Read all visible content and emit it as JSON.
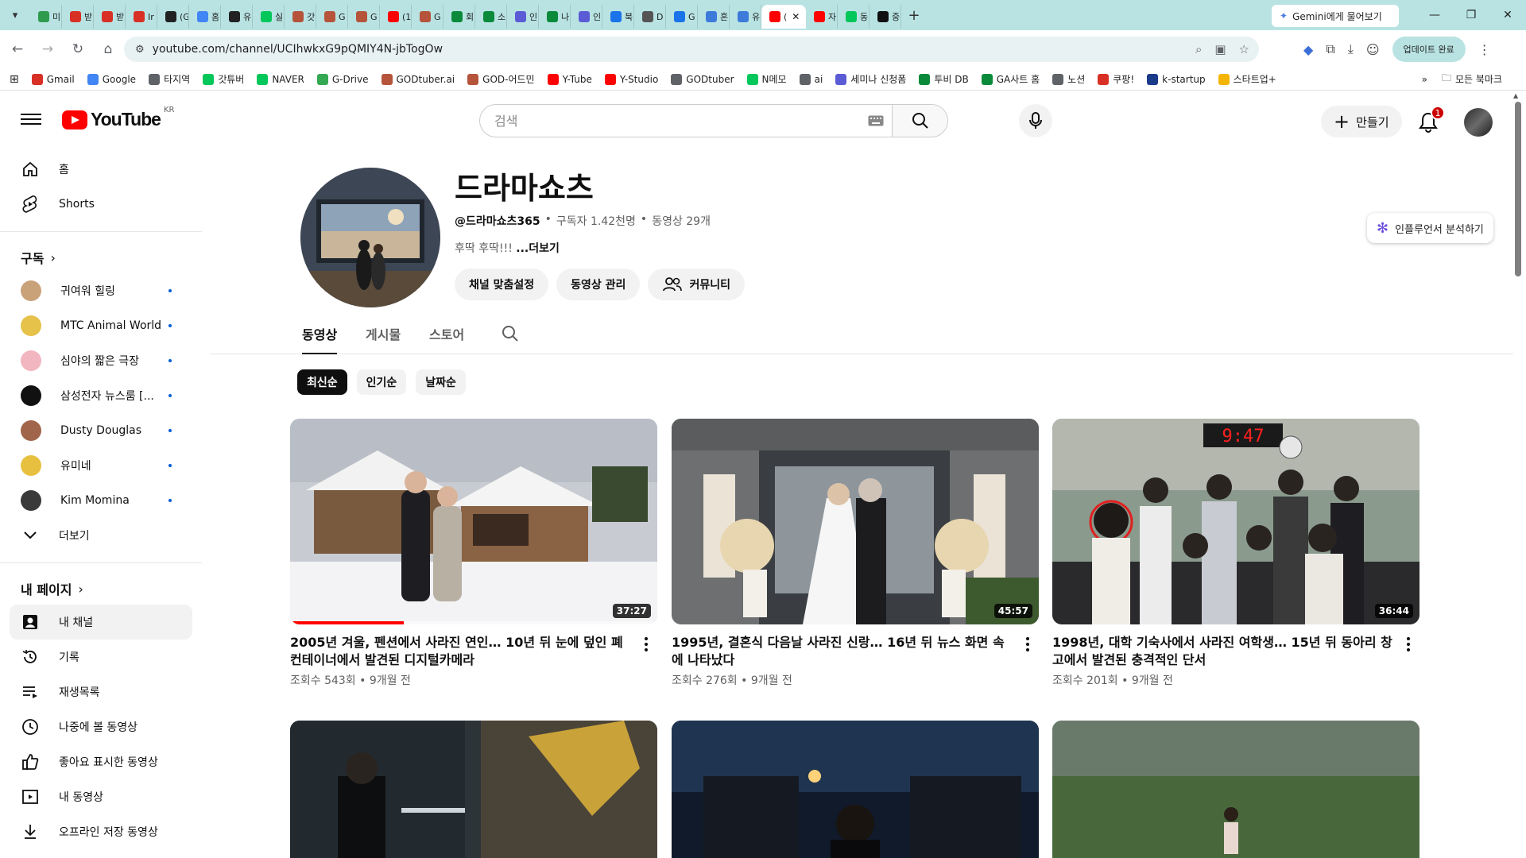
{
  "browser": {
    "tabs": [
      {
        "label": "미",
        "color": "#2e9b4f"
      },
      {
        "label": "받",
        "color": "#d93025"
      },
      {
        "label": "받",
        "color": "#d93025"
      },
      {
        "label": "Ir",
        "color": "#d93025"
      },
      {
        "label": "(G",
        "color": "#222222"
      },
      {
        "label": "홈",
        "color": "#4285f4"
      },
      {
        "label": "유",
        "color": "#222222"
      },
      {
        "label": "실",
        "color": "#03c75a"
      },
      {
        "label": "갓",
        "color": "#b5543b"
      },
      {
        "label": "G",
        "color": "#b5543b"
      },
      {
        "label": "G",
        "color": "#b5543b"
      },
      {
        "label": "(1",
        "color": "#ff0000"
      },
      {
        "label": "G",
        "color": "#b5543b"
      },
      {
        "label": "회",
        "color": "#0a8a3a"
      },
      {
        "label": "소",
        "color": "#0a8a3a"
      },
      {
        "label": "인",
        "color": "#5b5bd6"
      },
      {
        "label": "나",
        "color": "#0a8a3a"
      },
      {
        "label": "인",
        "color": "#5b5bd6"
      },
      {
        "label": "북",
        "color": "#1a73e8"
      },
      {
        "label": "D",
        "color": "#555555"
      },
      {
        "label": "G",
        "color": "#1a73e8"
      },
      {
        "label": "혼",
        "color": "#3c7bd9"
      },
      {
        "label": "유",
        "color": "#3c7bd9"
      },
      {
        "label": "(",
        "color": "#ff0000",
        "active": true
      },
      {
        "label": "자",
        "color": "#ff0000"
      },
      {
        "label": "동",
        "color": "#03c75a"
      },
      {
        "label": "중",
        "color": "#111111"
      }
    ],
    "new_tab": "+",
    "gemini_label": "Gemini에게 물어보기",
    "url": "youtube.com/channel/UCIhwkxG9pQMIY4N-jbTogOw",
    "update_label": "업데이트 완료",
    "bookmarks": [
      {
        "label": "Gmail",
        "color": "#d93025"
      },
      {
        "label": "Google",
        "color": "#4285f4"
      },
      {
        "label": "타지역",
        "color": "#5f6368"
      },
      {
        "label": "갓튜버",
        "color": "#03c75a"
      },
      {
        "label": "NAVER",
        "color": "#03c75a"
      },
      {
        "label": "G-Drive",
        "color": "#34a853"
      },
      {
        "label": "GODtuber.ai",
        "color": "#b5543b"
      },
      {
        "label": "GOD-어드민",
        "color": "#b5543b"
      },
      {
        "label": "Y-Tube",
        "color": "#ff0000"
      },
      {
        "label": "Y-Studio",
        "color": "#ff0000"
      },
      {
        "label": "GODtuber",
        "color": "#5f6368"
      },
      {
        "label": "N메모",
        "color": "#03c75a"
      },
      {
        "label": "ai",
        "color": "#5f6368"
      },
      {
        "label": "세미나 신청폼",
        "color": "#5b5bd6"
      },
      {
        "label": "투비 DB",
        "color": "#0a8a3a"
      },
      {
        "label": "GA사트 홈",
        "color": "#0a8a3a"
      },
      {
        "label": "노션",
        "color": "#5f6368"
      },
      {
        "label": "쿠팡!",
        "color": "#d93025"
      },
      {
        "label": "k-startup",
        "color": "#1a3a8a"
      },
      {
        "label": "스타트업+",
        "color": "#f5b400"
      }
    ],
    "all_bookmarks": "모든 북마크"
  },
  "masthead": {
    "logo_text": "YouTube",
    "logo_region": "KR",
    "search_placeholder": "검색",
    "create_label": "만들기",
    "notif_count": "1"
  },
  "sidebar": {
    "home": "홈",
    "shorts": "Shorts",
    "subs_header": "구독",
    "subscriptions": [
      {
        "name": "귀여워 힐링",
        "color": "#c9a27a"
      },
      {
        "name": "MTC Animal World",
        "color": "#e6c24a"
      },
      {
        "name": "심야의 짧은 극장",
        "color": "#f2b6c0"
      },
      {
        "name": "삼성전자 뉴스룸 [...",
        "color": "#111111"
      },
      {
        "name": "Dusty Douglas",
        "color": "#a0654a"
      },
      {
        "name": "유미네",
        "color": "#e8c040"
      },
      {
        "name": "Kim Momina",
        "color": "#3a3a3a"
      }
    ],
    "show_more": "더보기",
    "my_page_header": "내 페이지",
    "my_items": [
      {
        "label": "내 채널",
        "icon": "my-channel-icon"
      },
      {
        "label": "기록",
        "icon": "history-icon"
      },
      {
        "label": "재생목록",
        "icon": "playlist-icon"
      },
      {
        "label": "나중에 볼 동영상",
        "icon": "watch-later-icon"
      },
      {
        "label": "좋아요 표시한 동영상",
        "icon": "like-icon"
      },
      {
        "label": "내 동영상",
        "icon": "my-videos-icon"
      },
      {
        "label": "오프라인 저장 동영상",
        "icon": "download-icon"
      }
    ]
  },
  "channel": {
    "title": "드라마쇼츠",
    "handle": "@드라마쇼츠365",
    "subscribers": "구독자 1.42천명",
    "video_count": "동영상 29개",
    "sep": "•",
    "description": "후딱 후딱!!! ",
    "more": "...더보기",
    "buttons": {
      "customize": "채널 맞춤설정",
      "manage": "동영상 관리",
      "community": "커뮤니티"
    },
    "analyze": "인플루언서 분석하기",
    "tabs": [
      "동영상",
      "게시물",
      "스토어"
    ],
    "chips": [
      "최신순",
      "인기순",
      "날짜순"
    ]
  },
  "videos": [
    {
      "title": "2005년 겨울, 펜션에서 사라진 연인… 10년 뒤 눈에 덮인 폐컨테이너에서 발견된 디지털카메라",
      "meta": "조회수 543회 • 9개월 전",
      "duration": "37:27",
      "progress": 0.31
    },
    {
      "title": "1995년, 결혼식 다음날 사라진 신랑… 16년 뒤 뉴스 화면 속에 나타났다",
      "meta": "조회수 276회 • 9개월 전",
      "duration": "45:57"
    },
    {
      "title": "1998년, 대학 기숙사에서 사라진 여학생… 15년 뒤 동아리 창고에서 발견된 충격적인 단서",
      "meta": "조회수 201회 • 9개월 전",
      "duration": "36:44"
    },
    {
      "title": "",
      "meta": "",
      "duration": ""
    },
    {
      "title": "",
      "meta": "",
      "duration": ""
    },
    {
      "title": "",
      "meta": "",
      "duration": ""
    }
  ],
  "thumb_clock": "9:47"
}
